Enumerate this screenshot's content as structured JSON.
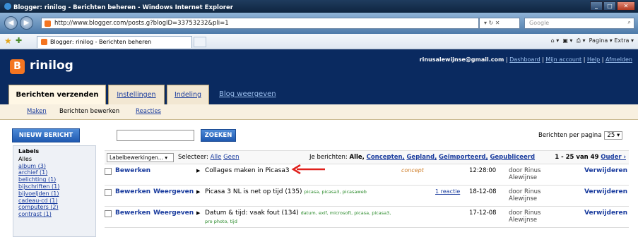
{
  "window": {
    "title": "Blogger: rinilog - Berichten beheren - Windows Internet Explorer",
    "url": "http://www.blogger.com/posts.g?blogID=33753232&pli=1",
    "search_placeholder": "Google",
    "tab_title": "Blogger: rinilog - Berichten beheren",
    "toolbar_right": "Pagina ▾   Extra ▾"
  },
  "header": {
    "blog_name": "rinilog",
    "email": "rinusalewijnse@gmail.com",
    "links": [
      "Dashboard",
      "Mijn account",
      "Help",
      "Afmelden"
    ]
  },
  "tabs": [
    "Berichten verzenden",
    "Instellingen",
    "Indeling"
  ],
  "view_blog": "Blog weergeven",
  "subtabs": [
    "Maken",
    "Berichten bewerken",
    "Reacties"
  ],
  "buttons": {
    "new_post": "NIEUW BERICHT",
    "search": "ZOEKEN"
  },
  "per_page": {
    "label": "Berichten per pagina",
    "value": "25"
  },
  "labels": {
    "title": "Labels",
    "items": [
      "Alles",
      "album (3)",
      "archief (1)",
      "belichting (1)",
      "bijschriften (1)",
      "bijvoeljden (1)",
      "cadeau-cd (1)",
      "computers (2)",
      "contrast (1)"
    ]
  },
  "actionbar": {
    "label_select": "Labelbewerkingen...",
    "select_label": "Selecteer:",
    "select_all": "Alle",
    "select_none": "Geen",
    "filter_label": "Je berichten:",
    "filter_all": "Alle,",
    "filters": [
      "Concepten,",
      "Gepland,",
      "Geïmporteerd,",
      "Gepubliceerd"
    ],
    "range": "1 - 25 van 49",
    "next": "Ouder ›"
  },
  "posts": [
    {
      "edit": "Bewerken",
      "view": "",
      "title": "Collages maken in Picasa3",
      "tags": "",
      "tags2": "",
      "status": "concept",
      "comments": "",
      "date": "12:28:00",
      "author1": "door Rinus",
      "author2": "Alewijnse",
      "delete": "Verwijderen"
    },
    {
      "edit": "Bewerken",
      "view": "Weergeven",
      "title": "Picasa 3 NL is net op tijd (135)",
      "tags": "picasa, picasa3, picasaweb",
      "tags2": "",
      "status": "",
      "comments": "1 reactie",
      "date": "18-12-08",
      "author1": "door Rinus",
      "author2": "Alewijnse",
      "delete": "Verwijderen"
    },
    {
      "edit": "Bewerken",
      "view": "Weergeven",
      "title": "Datum & tijd: vaak fout (134)",
      "tags": "datum, exif, microsoft, picasa, picasa3,",
      "tags2": "pro photo, tijd",
      "status": "",
      "comments": "",
      "date": "17-12-08",
      "author1": "door Rinus",
      "author2": "Alewijnse",
      "delete": "Verwijderen"
    }
  ],
  "colors": {
    "header_bg": "#0a2a60",
    "button_blue": "#1f59b0",
    "arrow_red": "#e0201c"
  }
}
